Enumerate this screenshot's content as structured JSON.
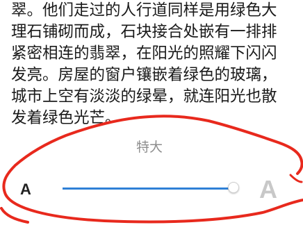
{
  "reader": {
    "lines": [
      "翠。他们走过的人行道同样是用绿色大",
      "理石铺砌而成，石块接合处嵌有一排排",
      "紧密相连的翡翠，在阳光的照耀下闪闪",
      "发亮。房屋的窗户镶嵌着绿色的玻璃，",
      "城市上空有淡淡的绿晕，就连阳光也散",
      "发着绿色光芒。"
    ]
  },
  "font_size_panel": {
    "current_size_label": "特大",
    "small_label": "A",
    "large_label": "A",
    "slider_level": 1.0,
    "accent_color": "#2f80d6"
  },
  "annotation": {
    "stroke_color": "#e8291d"
  }
}
